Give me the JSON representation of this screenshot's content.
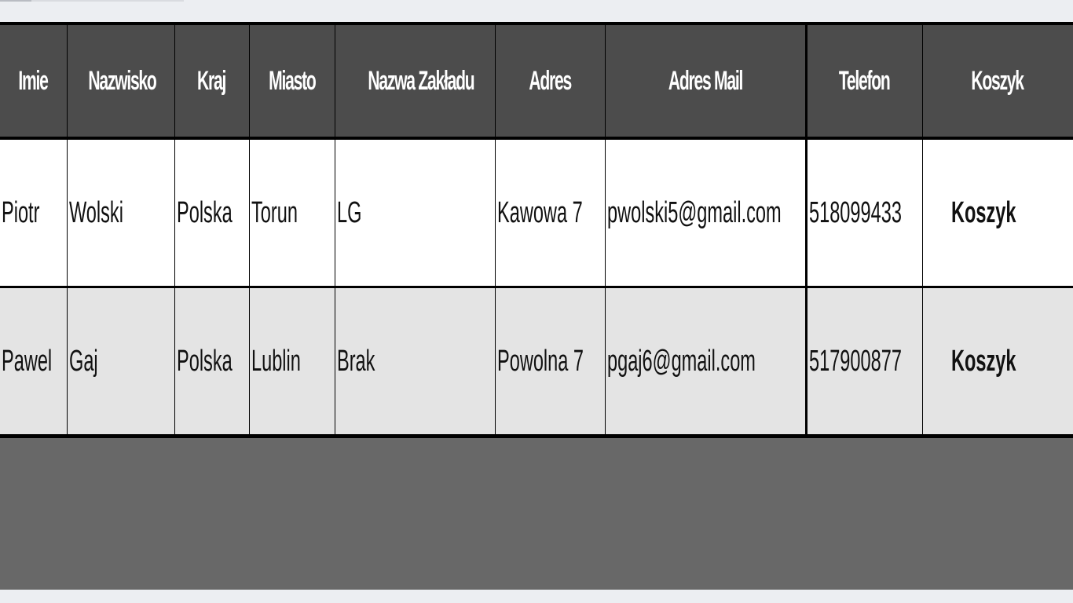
{
  "table": {
    "headers": [
      "Imie",
      "Nazwisko",
      "Kraj",
      "Miasto",
      "Nazwa Zakładu",
      "Adres",
      "Adres Mail",
      "Telefon",
      "Koszyk"
    ],
    "rows": [
      {
        "imie": "Piotr",
        "nazwisko": "Wolski",
        "kraj": "Polska",
        "miasto": "Torun",
        "zaklad": "LG",
        "adres": "Kawowa 7",
        "mail": "pwolski5@gmail.com",
        "telefon": "518099433",
        "koszyk": "Koszyk"
      },
      {
        "imie": "Pawel",
        "nazwisko": "Gaj",
        "kraj": "Polska",
        "miasto": "Lublin",
        "zaklad": "Brak",
        "adres": "Powolna 7",
        "mail": "pgaj6@gmail.com",
        "telefon": "517900877",
        "koszyk": "Koszyk"
      }
    ]
  },
  "colors": {
    "header_bg": "#4c4c4c",
    "row_odd": "#ffffff",
    "row_even": "#e4e4e4",
    "footer_bg": "#686868"
  }
}
